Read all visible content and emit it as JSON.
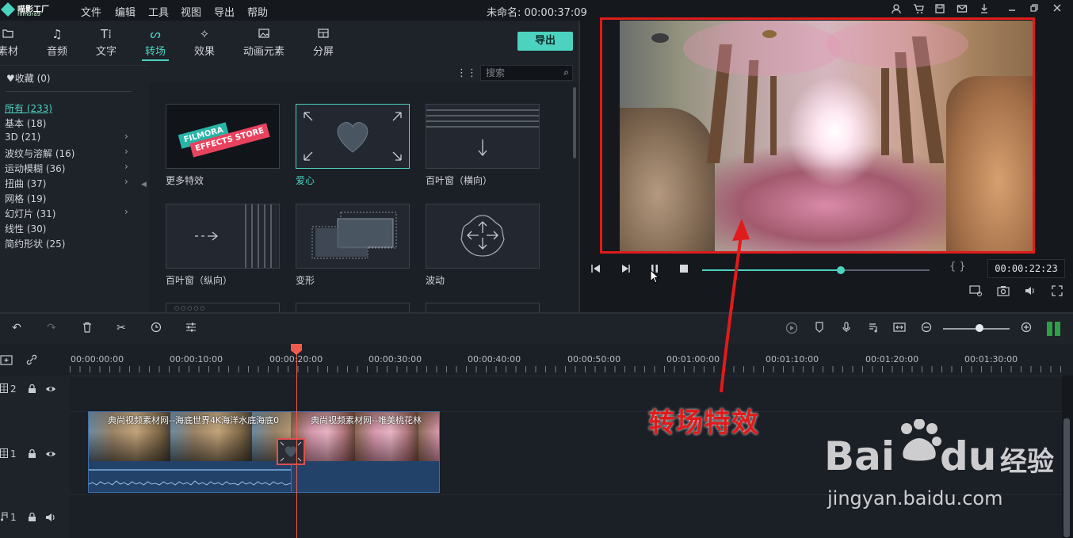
{
  "app": {
    "logo_text": "喵影工厂",
    "logo_sub": "filmora9",
    "menu": [
      "文件",
      "编辑",
      "工具",
      "视图",
      "导出",
      "帮助"
    ],
    "project_title": "未命名: 00:00:37:09"
  },
  "tabs": [
    {
      "label": "素材",
      "icon": "folder-icon"
    },
    {
      "label": "音频",
      "icon": "music-note-icon"
    },
    {
      "label": "文字",
      "icon": "text-icon"
    },
    {
      "label": "转场",
      "icon": "transition-icon",
      "active": true
    },
    {
      "label": "效果",
      "icon": "effects-icon"
    },
    {
      "label": "动画元素",
      "icon": "image-icon"
    },
    {
      "label": "分屏",
      "icon": "split-screen-icon"
    }
  ],
  "export_label": "导出",
  "sidebar": {
    "favorites": "♥收藏 (0)",
    "categories": [
      {
        "label": "所有 (233)",
        "active": true,
        "arrow": false
      },
      {
        "label": "基本 (18)",
        "arrow": false
      },
      {
        "label": "3D (21)",
        "arrow": true
      },
      {
        "label": "波纹与溶解 (16)",
        "arrow": true
      },
      {
        "label": "运动模糊 (36)",
        "arrow": true
      },
      {
        "label": "扭曲 (37)",
        "arrow": true
      },
      {
        "label": "网格 (19)",
        "arrow": false
      },
      {
        "label": "幻灯片 (31)",
        "arrow": true
      },
      {
        "label": "线性 (30)",
        "arrow": false
      },
      {
        "label": "简约形状 (25)",
        "arrow": false
      }
    ]
  },
  "search": {
    "placeholder": "搜索"
  },
  "effects": [
    {
      "label": "更多特效",
      "banner1": "FILMORA",
      "banner2": "EFFECTS STORE"
    },
    {
      "label": "爱心",
      "selected": true
    },
    {
      "label": "百叶窗（横向）"
    },
    {
      "label": "百叶窗（纵向）"
    },
    {
      "label": "变形"
    },
    {
      "label": "波动"
    }
  ],
  "player": {
    "timecode": "00:00:22:23",
    "brackets": "{ }",
    "progress": 0.61
  },
  "timeline": {
    "ticks": [
      "00:00:00:00",
      "00:00:10:00",
      "00:00:20:00",
      "00:00:30:00",
      "00:00:40:00",
      "00:00:50:00",
      "00:01:00:00",
      "00:01:10:00",
      "00:01:20:00",
      "00:01:30:00"
    ],
    "zoom": 0.55,
    "tracks": [
      {
        "label": "2"
      },
      {
        "label": "1"
      },
      {
        "label": "1"
      }
    ],
    "clips": [
      {
        "title": "典尚视频素材网--海底世界4K海洋水底海底0"
      },
      {
        "title": "典尚视频素材网--唯美桃花林"
      }
    ]
  },
  "annotation": "转场特效",
  "watermark": {
    "brand": "Bai",
    "brand2": "du",
    "suffix": "经验",
    "url": "jingyan.baidu.com"
  }
}
